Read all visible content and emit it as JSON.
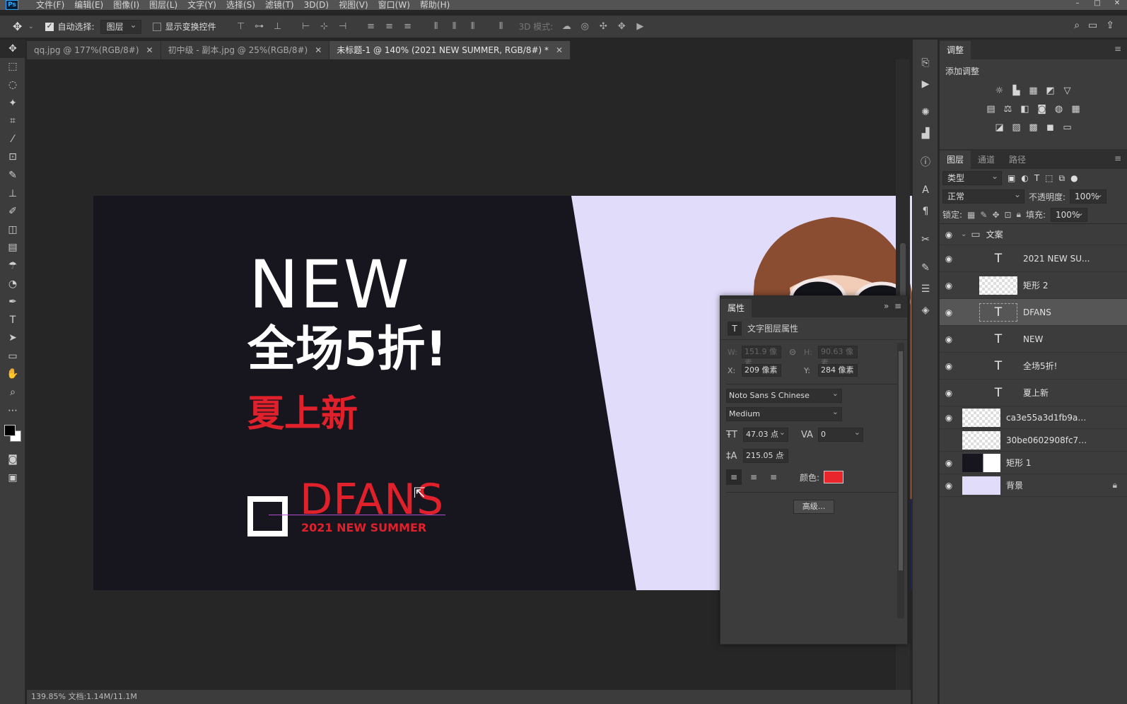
{
  "app": {
    "logo": "Ps",
    "menu": [
      "文件(F)",
      "编辑(E)",
      "图像(I)",
      "图层(L)",
      "文字(Y)",
      "选择(S)",
      "滤镜(T)",
      "3D(D)",
      "视图(V)",
      "窗口(W)",
      "帮助(H)"
    ]
  },
  "options_bar": {
    "auto_select_label": "自动选择:",
    "auto_select_checked": true,
    "auto_select_value": "图层",
    "show_transform_label": "显示变换控件",
    "mode3d_label": "3D 模式:"
  },
  "tabs": [
    {
      "label": "qq.jpg @ 177%(RGB/8#)",
      "active": false
    },
    {
      "label": "初中级 - 副本.jpg @ 25%(RGB/8#)",
      "active": false
    },
    {
      "label": "未标题-1 @ 140% (2021 NEW SUMMER, RGB/8#) *",
      "active": true
    }
  ],
  "canvas": {
    "new_text": "NEW",
    "sale_text": "全场5折!",
    "summer_cn": "夏上新",
    "brand": "DFANS",
    "tagline": "2021 NEW SUMMER",
    "accent_color": "#e0212b",
    "dark_bg": "#17161f",
    "lavender_bg": "#e2dcfb"
  },
  "status": "139.85%  文档:1.14M/11.1M",
  "adjustments": {
    "tab": "调整",
    "add_title": "添加调整"
  },
  "layers_panel": {
    "tabs": [
      "图层",
      "通道",
      "路径"
    ],
    "filter_type": "类型",
    "blend_mode": "正常",
    "opacity_label": "不透明度:",
    "opacity": "100%",
    "lock_label": "锁定:",
    "fill_label": "填充:",
    "fill": "100%",
    "layers": [
      {
        "name": "文案",
        "kind": "group",
        "visible": true,
        "selected": false
      },
      {
        "name": "2021 NEW SU...",
        "kind": "text",
        "visible": true,
        "selected": false
      },
      {
        "name": "矩形 2",
        "kind": "shape-checker",
        "visible": true,
        "selected": false
      },
      {
        "name": "DFANS",
        "kind": "text",
        "visible": true,
        "selected": true
      },
      {
        "name": "NEW",
        "kind": "text",
        "visible": true,
        "selected": false
      },
      {
        "name": "全场5折!",
        "kind": "text",
        "visible": true,
        "selected": false
      },
      {
        "name": "夏上新",
        "kind": "text",
        "visible": true,
        "selected": false
      },
      {
        "name": "ca3e55a3d1fb9a59b...",
        "kind": "image",
        "visible": true,
        "selected": false
      },
      {
        "name": "30be0602908fc7559...",
        "kind": "image",
        "visible": false,
        "selected": false
      },
      {
        "name": "矩形 1",
        "kind": "shape-dark",
        "visible": true,
        "selected": false
      },
      {
        "name": "背景",
        "kind": "background",
        "visible": true,
        "selected": false,
        "locked": true
      }
    ]
  },
  "properties": {
    "tab": "属性",
    "subtitle": "文字图层属性",
    "w_label": "W:",
    "w_value": "151.9 像素",
    "h_label": "H:",
    "h_value": "90.63 像素",
    "x_label": "X:",
    "x_value": "209 像素",
    "y_label": "Y:",
    "y_value": "284 像素",
    "font_family": "Noto Sans S Chinese",
    "font_style": "Medium",
    "font_size": "47.03 点",
    "tracking": "0",
    "leading": "215.05 点",
    "color_label": "颜色:",
    "color": "#e8262b",
    "advanced_label": "高级..."
  }
}
